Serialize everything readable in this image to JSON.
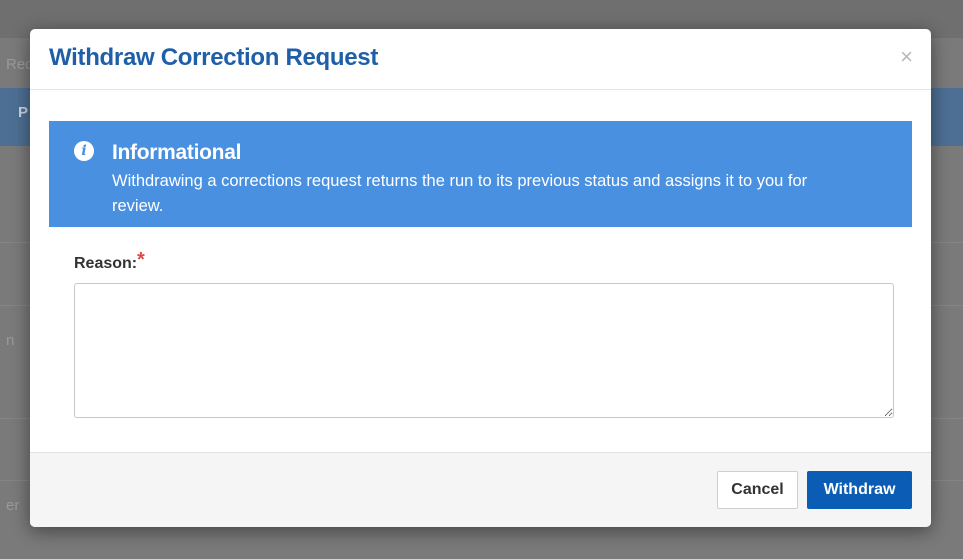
{
  "background": {
    "fragments": [
      "Req",
      "P",
      "n",
      "er"
    ]
  },
  "modal": {
    "title": "Withdraw Correction Request",
    "close_glyph": "×",
    "info": {
      "icon": "info-circle-icon",
      "title": "Informational",
      "text": "Withdrawing a corrections request returns the run to its previous status and assigns it to you for review."
    },
    "form": {
      "reason_label": "Reason:",
      "required_marker": "*",
      "reason_value": ""
    },
    "footer": {
      "cancel_label": "Cancel",
      "withdraw_label": "Withdraw"
    }
  },
  "colors": {
    "title": "#1f5fa8",
    "info_bg": "#4a90e0",
    "primary_button": "#0b5cb4",
    "required": "#e04848"
  }
}
